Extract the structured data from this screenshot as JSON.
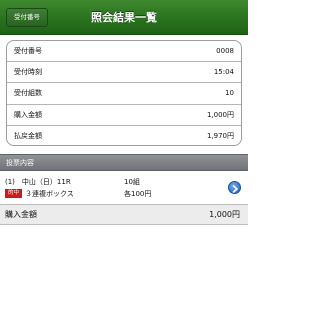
{
  "navbar": {
    "back_label": "受付番号",
    "title": "照会結果一覧"
  },
  "summary": [
    {
      "label": "受付番号",
      "value": "0008"
    },
    {
      "label": "受付時刻",
      "value": "15:04"
    },
    {
      "label": "受付組数",
      "value": "10"
    },
    {
      "label": "購入金額",
      "value": "1,000円"
    },
    {
      "label": "払戻金額",
      "value": "1,970円"
    }
  ],
  "bets": {
    "header": "投票内容",
    "items": [
      {
        "race": "(1)　中山（日）11R",
        "combos": "10組",
        "badge": "的中",
        "type": "３連複ボックス",
        "unit": "各100円"
      }
    ]
  },
  "total": {
    "label": "購入金額",
    "value": "1,000円"
  },
  "colors": {
    "navbar": "#2c7420",
    "hit_badge": "#cc1a1a",
    "detail_button": "#2462b8"
  }
}
